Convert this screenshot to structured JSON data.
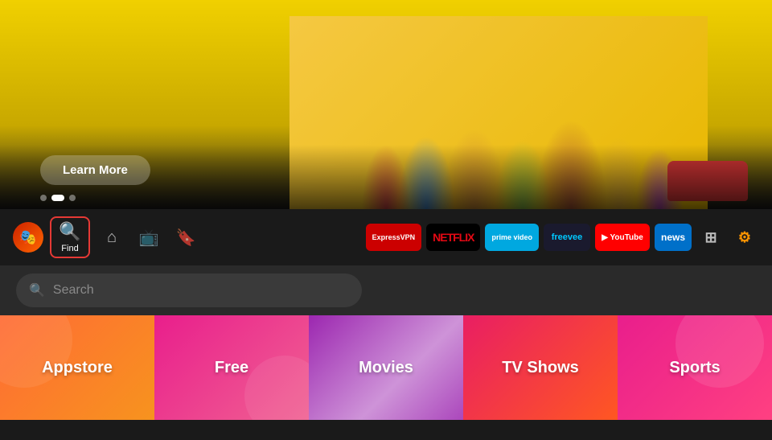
{
  "hero": {
    "learn_more_label": "Learn More",
    "dots": [
      {
        "active": false
      },
      {
        "active": true
      },
      {
        "active": false
      }
    ]
  },
  "nav": {
    "avatar_emoji": "🎭",
    "find_label": "Find",
    "find_icon": "🔍",
    "home_icon": "⌂",
    "tv_icon": "📺",
    "bookmark_icon": "🔖"
  },
  "channels": [
    {
      "id": "expressvpn",
      "label": "ExpressVPN",
      "class": "logo-expressvpn"
    },
    {
      "id": "netflix",
      "label": "NETFLIX",
      "class": "logo-netflix"
    },
    {
      "id": "prime",
      "label": "prime video",
      "class": "logo-prime"
    },
    {
      "id": "freevee",
      "label": "freevee",
      "class": "logo-freevee"
    },
    {
      "id": "youtube",
      "label": "▶ YouTube",
      "class": "logo-youtube"
    },
    {
      "id": "news",
      "label": "news",
      "class": "logo-news"
    },
    {
      "id": "apps",
      "label": "⊞",
      "class": "logo-apps"
    },
    {
      "id": "settings",
      "label": "⚙",
      "class": "logo-settings"
    }
  ],
  "search": {
    "placeholder": "Search"
  },
  "categories": [
    {
      "id": "appstore",
      "label": "Appstore",
      "class": "cat-appstore"
    },
    {
      "id": "free",
      "label": "Free",
      "class": "cat-free"
    },
    {
      "id": "movies",
      "label": "Movies",
      "class": "cat-movies"
    },
    {
      "id": "tvshows",
      "label": "TV Shows",
      "class": "cat-tvshows"
    },
    {
      "id": "sports",
      "label": "Sports",
      "class": "cat-sports"
    }
  ]
}
